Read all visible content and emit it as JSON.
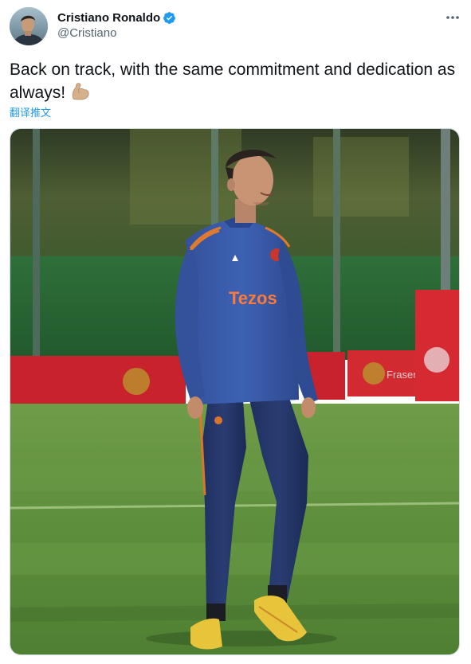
{
  "author": {
    "display_name": "Cristiano Ronaldo",
    "handle": "@Cristiano",
    "verified": true,
    "avatar_icon": "profile-photo"
  },
  "tweet": {
    "text": "Back on track, with the same commitment and dedication as always!",
    "emoji": "flexed-biceps",
    "translate_label": "翻译推文"
  },
  "media": {
    "sponsor_text": "Tezos",
    "banner_text": "Frasers"
  },
  "colors": {
    "link": "#1d9bf0",
    "verified": "#1d9bf0",
    "secondary_text": "#536471"
  }
}
